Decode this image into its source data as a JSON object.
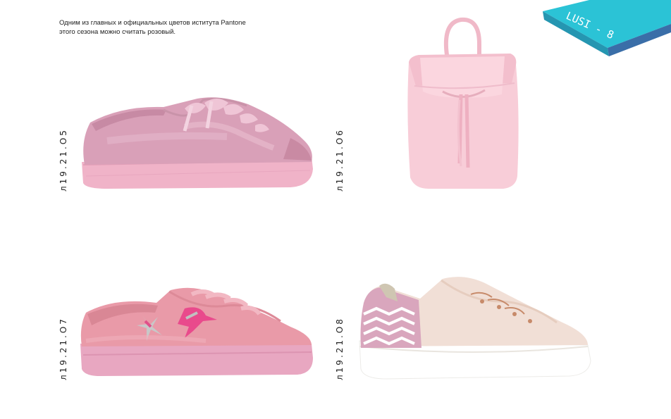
{
  "intro": {
    "line1": "Одним из главных и  официальных цветов  иститута Pantone",
    "line2": "этого сезона можно считать розовый."
  },
  "brand_tag": {
    "label": "LUSI - 8",
    "colors": {
      "top": "#2bc3d6",
      "side": "#3a6ea8"
    }
  },
  "products": [
    {
      "code": "л19.21.О5",
      "name": "pink satin sneaker with ribbon laces",
      "color": "#dca6bd"
    },
    {
      "code": "л19.21.О6",
      "name": "pink mini backpack",
      "color": "#f6c8d3"
    },
    {
      "code": "л19.21.О7",
      "name": "pink leather sneaker with embroidered birds",
      "color": "#e48fa2"
    },
    {
      "code": "л19.21.О8",
      "name": "beige sneaker with chevron heel",
      "color": "#f1dfd6"
    }
  ]
}
